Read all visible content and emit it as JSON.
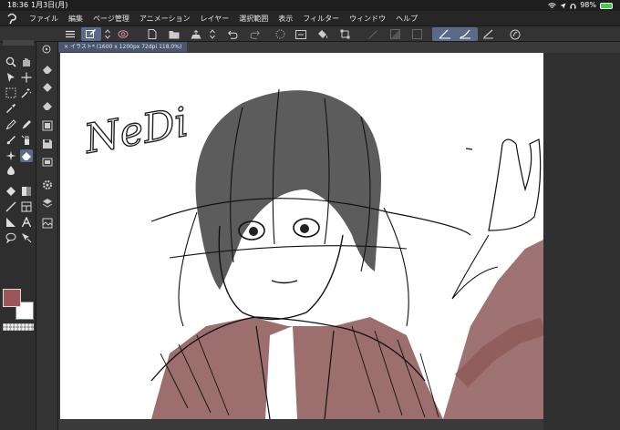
{
  "status": {
    "time": "18:36",
    "date": "1月3日(月)",
    "battery": "98%"
  },
  "menu": {
    "items": [
      "ファイル",
      "編集",
      "ページ管理",
      "アニメーション",
      "レイヤー",
      "選択範囲",
      "表示",
      "フィルター",
      "ウィンドウ",
      "ヘルプ"
    ]
  },
  "document": {
    "tab_title": "イラスト* (1600 x 1200px 72dpi 118.0%)"
  },
  "canvas": {
    "handwritten_text": "NeDi"
  },
  "colors": {
    "main_color": "#9a5658",
    "sub_color": "#ffffff",
    "accent": "#5b6a86"
  }
}
